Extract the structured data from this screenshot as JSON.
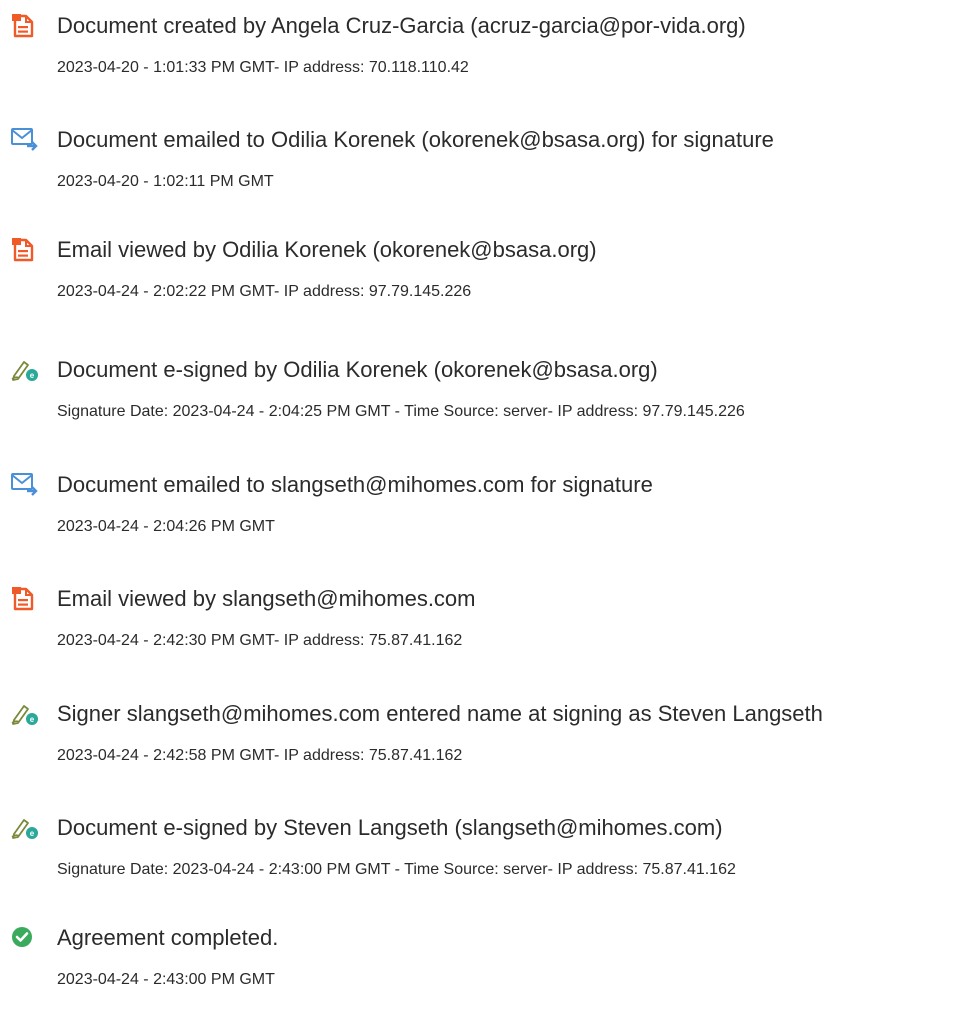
{
  "events": [
    {
      "icon": "document-orange-icon",
      "title": "Document created by Angela Cruz-Garcia (acruz-garcia@por-vida.org)",
      "detail": "2023-04-20 - 1:01:33 PM GMT- IP address: 70.118.110.42"
    },
    {
      "icon": "email-send-icon",
      "title": "Document emailed to Odilia Korenek (okorenek@bsasa.org) for signature",
      "detail": "2023-04-20 - 1:02:11 PM GMT"
    },
    {
      "icon": "document-orange-icon",
      "title": "Email viewed by Odilia Korenek (okorenek@bsasa.org)",
      "detail": "2023-04-24 - 2:02:22 PM GMT- IP address: 97.79.145.226"
    },
    {
      "icon": "pen-sign-icon",
      "title": "Document e-signed by Odilia Korenek (okorenek@bsasa.org)",
      "detail": "Signature Date: 2023-04-24 - 2:04:25 PM GMT - Time Source: server- IP address: 97.79.145.226"
    },
    {
      "icon": "email-send-icon",
      "title": "Document emailed to slangseth@mihomes.com for signature",
      "detail": "2023-04-24 - 2:04:26 PM GMT"
    },
    {
      "icon": "document-orange-icon",
      "title": "Email viewed by slangseth@mihomes.com",
      "detail": "2023-04-24 - 2:42:30 PM GMT- IP address: 75.87.41.162"
    },
    {
      "icon": "pen-sign-icon",
      "title": "Signer slangseth@mihomes.com entered name at signing as Steven Langseth",
      "detail": "2023-04-24 - 2:42:58 PM GMT- IP address: 75.87.41.162"
    },
    {
      "icon": "pen-sign-icon",
      "title": "Document e-signed by Steven Langseth (slangseth@mihomes.com)",
      "detail": "Signature Date: 2023-04-24 - 2:43:00 PM GMT - Time Source: server- IP address: 75.87.41.162"
    },
    {
      "icon": "check-circle-icon",
      "title": "Agreement completed.",
      "detail": "2023-04-24 - 2:43:00 PM GMT"
    }
  ],
  "colors": {
    "document_orange": "#f05a28",
    "email_blue": "#4a90d9",
    "sign_teal": "#2aa89a",
    "check_green": "#3aaa5c",
    "text": "#2b2b2b"
  }
}
